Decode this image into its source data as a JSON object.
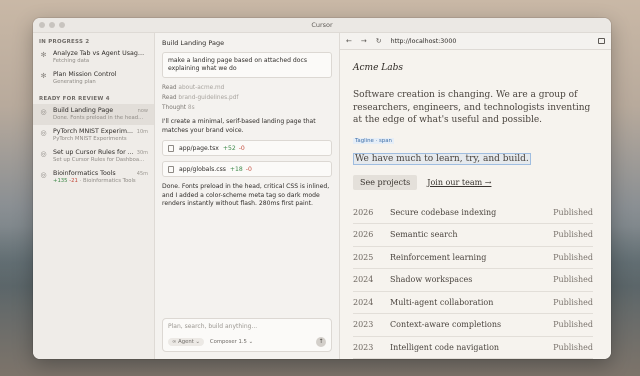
{
  "window": {
    "title": "Cursor"
  },
  "sidebar": {
    "sections": [
      {
        "label": "IN PROGRESS 2"
      },
      {
        "label": "READY FOR REVIEW 4"
      }
    ],
    "in_progress": [
      {
        "title": "Analyze Tab vs Agent Usage P...",
        "subtitle": "Fetching data"
      },
      {
        "title": "Plan Mission Control",
        "subtitle": "Generating plan"
      }
    ],
    "review": [
      {
        "title": "Build Landing Page",
        "subtitle": "Done. Fonts preload in the head...",
        "time": "now",
        "active": true
      },
      {
        "title": "PyTorch MNIST Experim...",
        "subtitle": "PyTorch MNIST Experiments",
        "time": "10m"
      },
      {
        "title": "Set up Cursor Rules for ...",
        "subtitle": "Set up Cursor Rules for Dashboa...",
        "time": "30m"
      },
      {
        "title": "Bioinformatics Tools",
        "subtitle": "Bioinformatics Tools",
        "time": "45m",
        "plus": "+135",
        "minus": "-21"
      }
    ]
  },
  "chat": {
    "title": "Build Landing Page",
    "prompt": "make a landing page based on attached docs explaining what we do",
    "read1_label": "Read",
    "read1_file": "about-acme.md",
    "read2_label": "Read",
    "read2_file": "brand-guidelines.pdf",
    "thought_label": "Thought",
    "thought_time": "8s",
    "response1": "I'll create a minimal, serif-based landing page that matches your brand voice.",
    "files": [
      {
        "name": "app/page.tsx",
        "plus": "+52",
        "minus": "-0"
      },
      {
        "name": "app/globals.css",
        "plus": "+18",
        "minus": "-0"
      }
    ],
    "response2": "Done. Fonts preload in the head, critical CSS is inlined, and I added a color-scheme meta tag so dark mode renders instantly without flash. 280ms first paint.",
    "composer_placeholder": "Plan, search, build anything...",
    "agent_chip": "∞ Agent ⌄",
    "model_chip": "Composer 1.5 ⌄"
  },
  "browser": {
    "back": "←",
    "forward": "→",
    "reload": "↻",
    "url": "http://localhost:3000",
    "site": {
      "brand": "Acme Labs",
      "hero": "Software creation is changing. We are a group of researchers, engineers, and technologists inventing at the edge of what's useful and possible.",
      "tag": "Tagline · span",
      "hero2": "We have much to learn, try, and build.",
      "button": "See projects",
      "link": "Join our team →",
      "projects": [
        {
          "year": "2026",
          "name": "Secure codebase indexing",
          "status": "Published"
        },
        {
          "year": "2026",
          "name": "Semantic search",
          "status": "Published"
        },
        {
          "year": "2025",
          "name": "Reinforcement learning",
          "status": "Published"
        },
        {
          "year": "2024",
          "name": "Shadow workspaces",
          "status": "Published"
        },
        {
          "year": "2024",
          "name": "Multi-agent collaboration",
          "status": "Published"
        },
        {
          "year": "2023",
          "name": "Context-aware completions",
          "status": "Published"
        },
        {
          "year": "2023",
          "name": "Intelligent code navigation",
          "status": "Published"
        }
      ]
    }
  }
}
